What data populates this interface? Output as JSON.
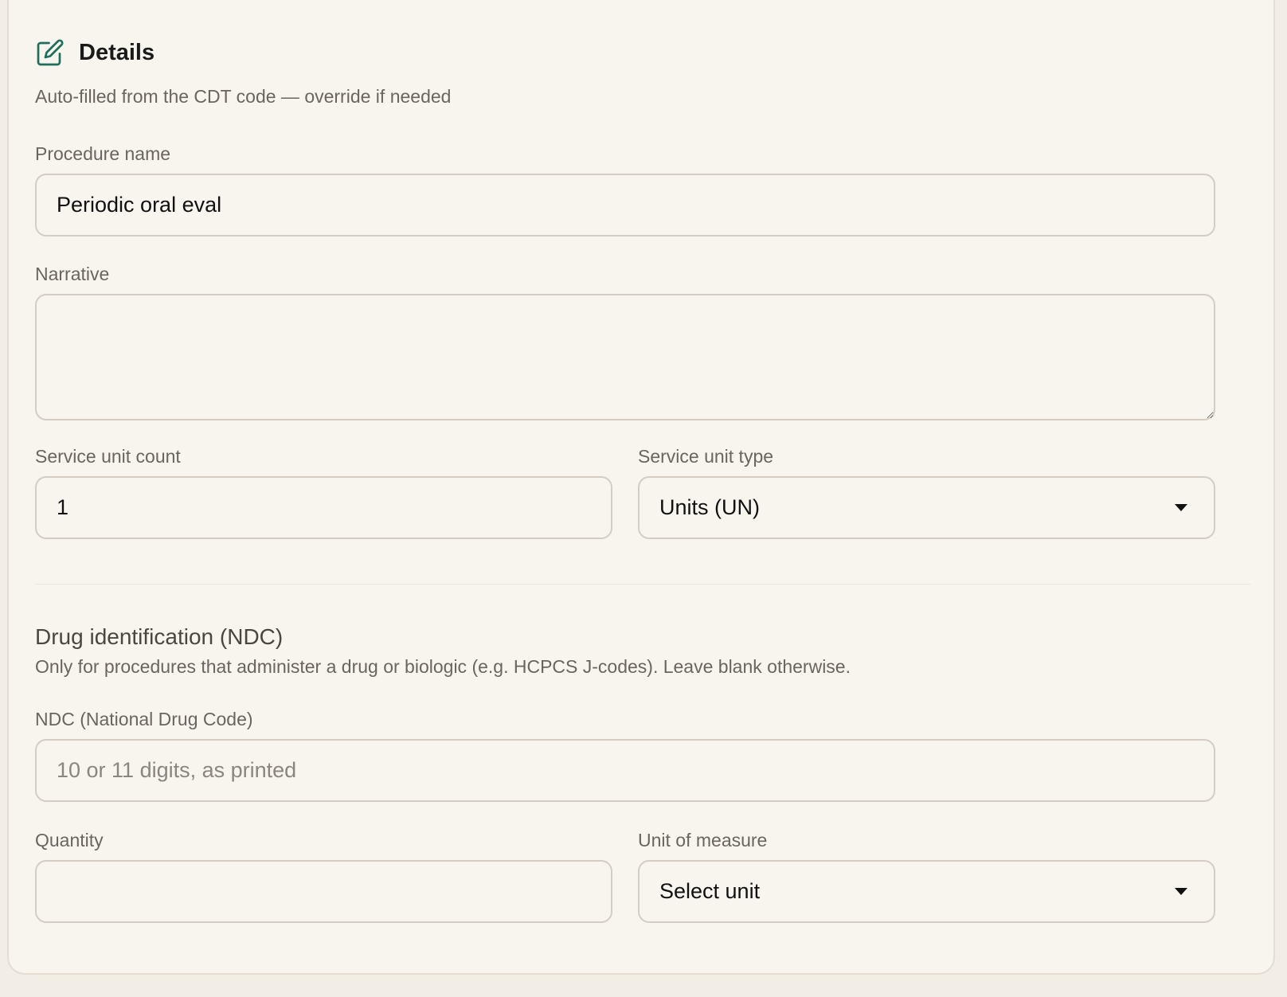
{
  "header": {
    "title": "Details",
    "subtitle": "Auto-filled from the CDT code — override if needed",
    "icon": "edit-icon"
  },
  "procedure_name": {
    "label": "Procedure name",
    "value": "Periodic oral eval"
  },
  "narrative": {
    "label": "Narrative",
    "value": ""
  },
  "service_unit_count": {
    "label": "Service unit count",
    "value": "1"
  },
  "service_unit_type": {
    "label": "Service unit type",
    "value": "Units (UN)"
  },
  "drug_section": {
    "title": "Drug identification (NDC)",
    "description": "Only for procedures that administer a drug or biologic (e.g. HCPCS J-codes). Leave blank otherwise."
  },
  "ndc": {
    "label": "NDC (National Drug Code)",
    "value": "",
    "placeholder": "10 or 11 digits, as printed"
  },
  "quantity": {
    "label": "Quantity",
    "value": ""
  },
  "unit_of_measure": {
    "label": "Unit of measure",
    "value": "Select unit"
  },
  "colors": {
    "accent": "#1f6f5c",
    "background": "#f8f4ee",
    "border": "#d3cdc3"
  }
}
